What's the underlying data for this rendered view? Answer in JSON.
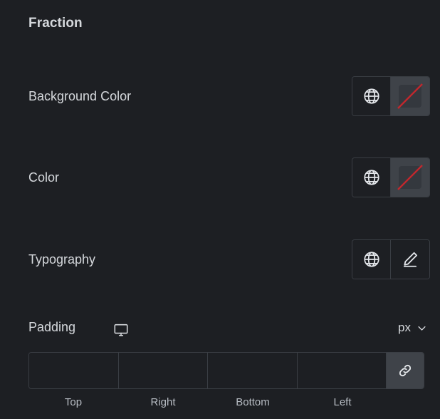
{
  "panel": {
    "section_title": "Fraction",
    "accent_empty_color": "#c0272d",
    "background": "#1d1f23",
    "control_bg": "#3f4349",
    "border_color": "#3a3e44",
    "text_color": "#d5d8dc"
  },
  "rows": [
    {
      "label": "Background Color",
      "globe_icon": "globe-icon",
      "value_icon": "no-color-swatch-icon",
      "value": ""
    },
    {
      "label": "Color",
      "globe_icon": "globe-icon",
      "value_icon": "no-color-swatch-icon",
      "value": ""
    },
    {
      "label": "Typography",
      "globe_icon": "globe-icon",
      "value_icon": "pencil-edit-icon",
      "value": ""
    }
  ],
  "padding": {
    "label": "Padding",
    "device_icon": "desktop-monitor-icon",
    "unit": "px",
    "unit_chevron_icon": "chevron-down-icon",
    "link_icon": "link-chain-icon",
    "fields": [
      {
        "caption": "Top",
        "value": "",
        "placeholder": ""
      },
      {
        "caption": "Right",
        "value": "",
        "placeholder": ""
      },
      {
        "caption": "Bottom",
        "value": "",
        "placeholder": ""
      },
      {
        "caption": "Left",
        "value": "",
        "placeholder": ""
      }
    ]
  }
}
